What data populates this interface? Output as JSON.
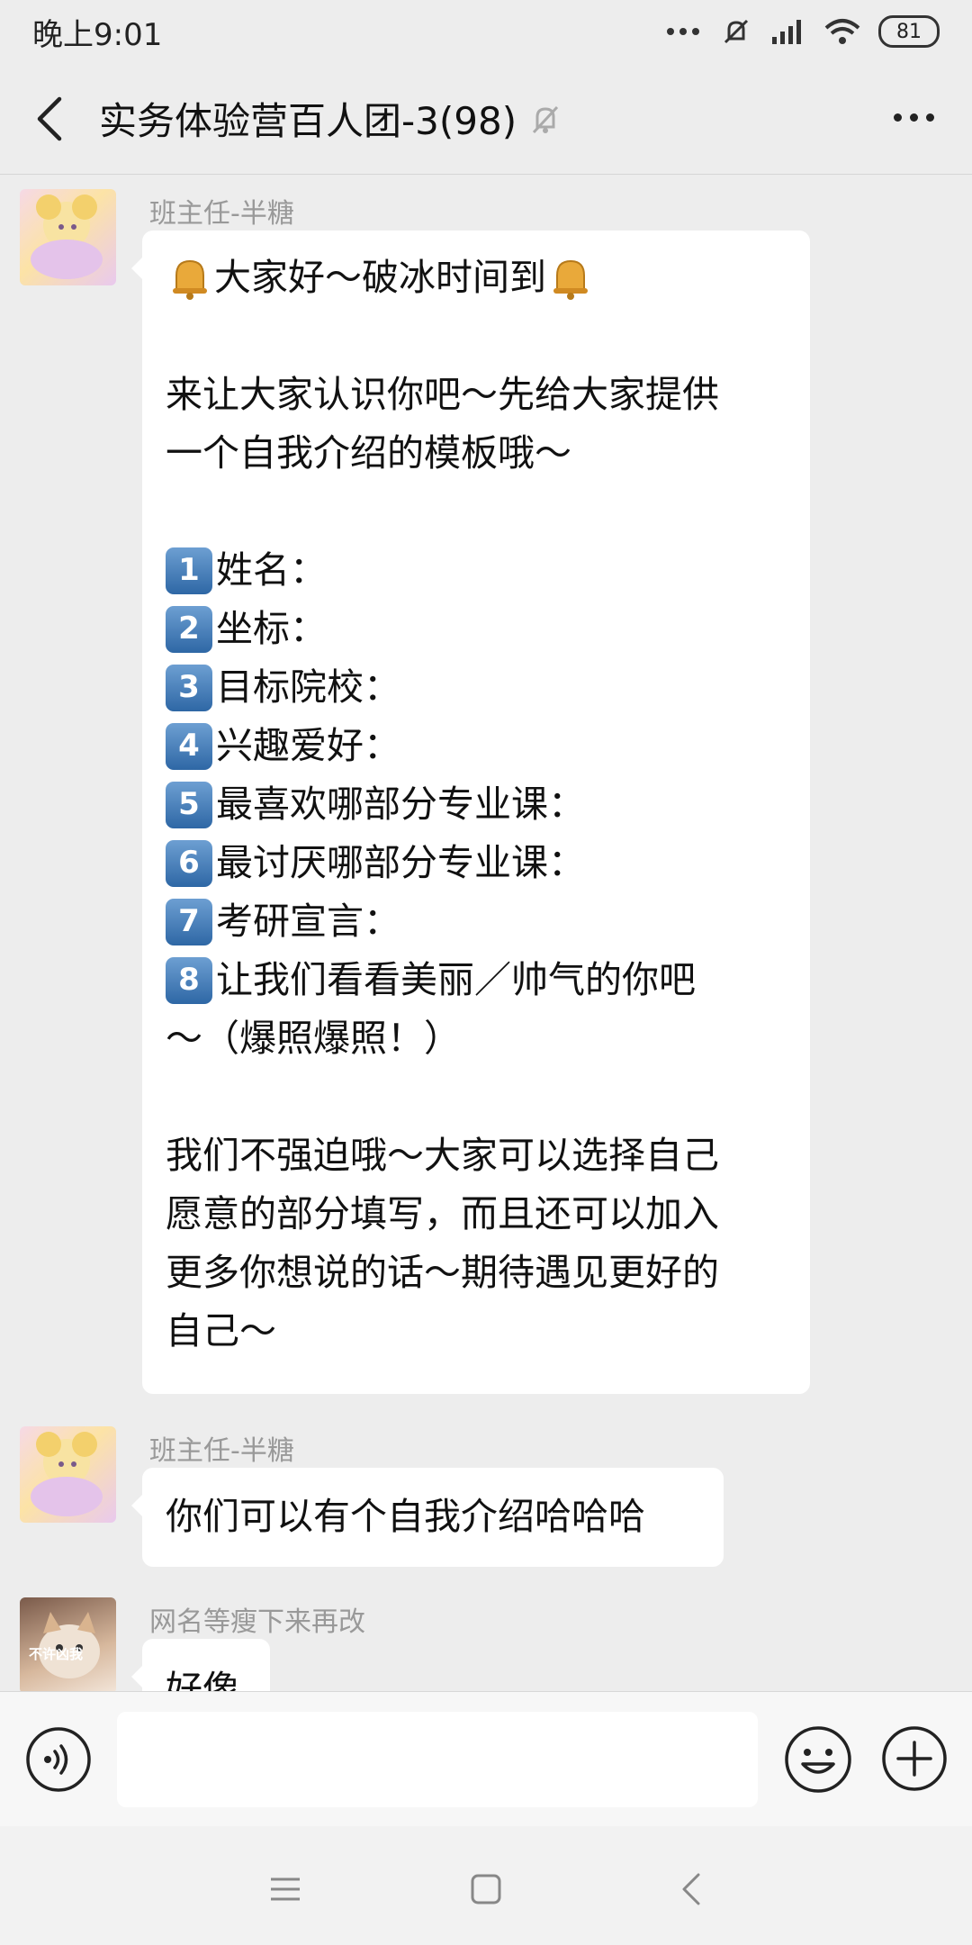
{
  "status_bar": {
    "time": "晚上9:01",
    "battery": "81"
  },
  "header": {
    "title": "实务体验营百人团-3(98)"
  },
  "messages": [
    {
      "sender": "班主任-半糖",
      "lines": [
        "大家好～破冰时间到",
        "",
        "来让大家认识你吧～先给大家提供",
        "一个自我介绍的模板哦～",
        "",
        "姓名：",
        "坐标：",
        "目标院校：",
        "兴趣爱好：",
        "最喜欢哪部分专业课：",
        "最讨厌哪部分专业课：",
        "考研宣言：",
        "让我们看看美丽／帅气的你吧",
        "～（爆照爆照！）",
        "",
        "我们不强迫哦～大家可以选择自己",
        "愿意的部分填写，而且还可以加入",
        "更多你想说的话～期待遇见更好的",
        "自己～"
      ],
      "number_keys": [
        "1",
        "2",
        "3",
        "4",
        "5",
        "6",
        "7",
        "8"
      ]
    },
    {
      "sender": "班主任-半糖",
      "text": "你们可以有个自我介绍哈哈哈"
    },
    {
      "sender": "网名等瘦下来再改",
      "avatar_caption": "不许凶我",
      "text": "好像"
    }
  ],
  "icons": {
    "back": "back-arrow-icon",
    "mute": "mute-bell-icon",
    "more": "more-dots-icon",
    "voice": "voice-icon",
    "emoji": "emoji-icon",
    "plus": "plus-icon"
  }
}
